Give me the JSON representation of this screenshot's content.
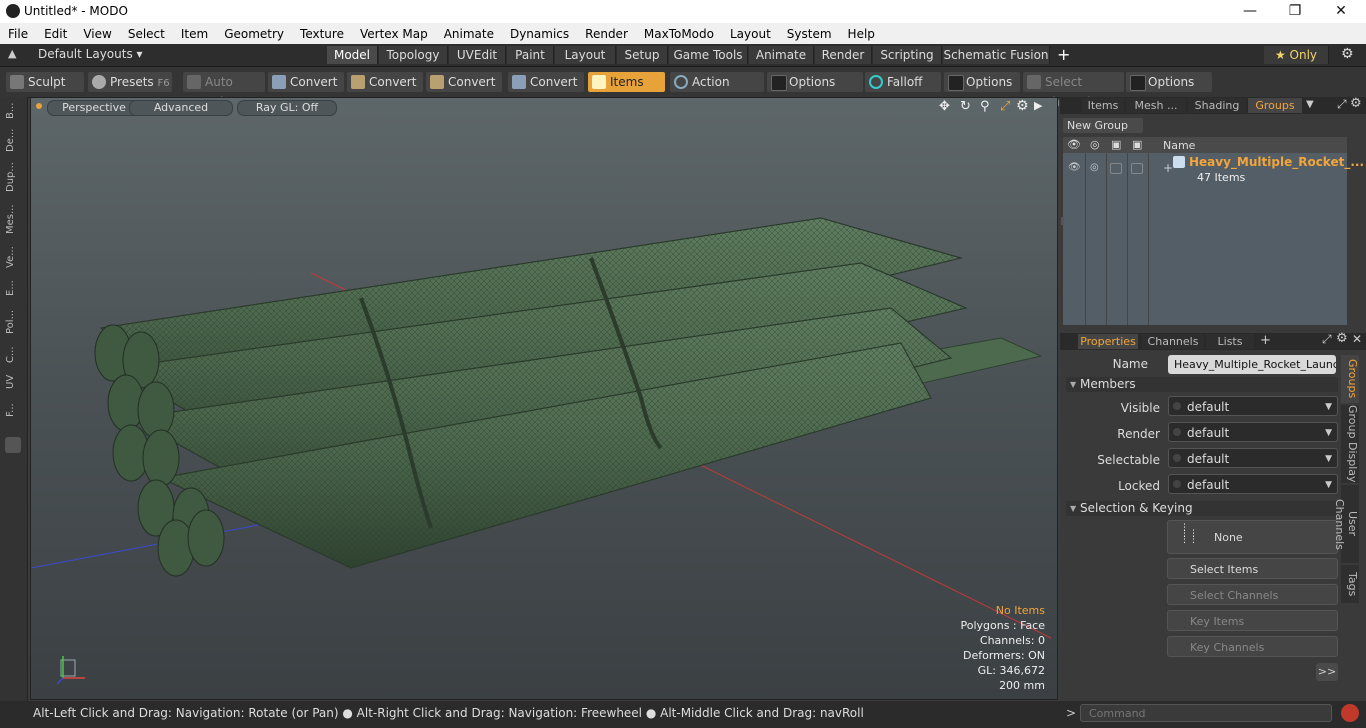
{
  "window": {
    "title": "Untitled* - MODO"
  },
  "menu": [
    "File",
    "Edit",
    "View",
    "Select",
    "Item",
    "Geometry",
    "Texture",
    "Vertex Map",
    "Animate",
    "Dynamics",
    "Render",
    "MaxToModo",
    "Layout",
    "System",
    "Help"
  ],
  "layout_bar": {
    "layouts_label": "Default Layouts ▾",
    "tabs": [
      "Model",
      "Topology",
      "UVEdit",
      "Paint",
      "Layout",
      "Setup",
      "Game Tools",
      "Animate",
      "Render",
      "Scripting",
      "Schematic Fusion"
    ],
    "plus": "+",
    "only_label": "★ Only"
  },
  "toolbar": {
    "sculpt": "Sculpt",
    "presets": "Presets",
    "presets_key": "F6",
    "auto_select": "Auto Select",
    "convert1": "Convert",
    "convert2": "Convert",
    "convert3": "Convert",
    "convert4": "Convert",
    "items": "Items",
    "action_center": "Action Center",
    "options1": "Options",
    "falloff": "Falloff",
    "options2": "Options",
    "select_through": "Select Through",
    "options3": "Options"
  },
  "left_strip": [
    "B...",
    "De...",
    "Dup...",
    "Mes...",
    "Ve...",
    "E...",
    "Pol...",
    "C...",
    "UV",
    "F..."
  ],
  "viewport": {
    "perspective": "Perspective",
    "advanced": "Advanced",
    "raygl": "Ray GL: Off",
    "info": {
      "no_items": "No Items",
      "polygons": "Polygons : Face",
      "channels": "Channels: 0",
      "deformers": "Deformers: ON",
      "gl": "GL: 346,672",
      "size": "200 mm"
    }
  },
  "right_panel": {
    "top_tabs": [
      "Items",
      "Mesh ...",
      "Shading",
      "Groups"
    ],
    "new_group": "New Group",
    "col_name": "Name",
    "group_name": "Heavy_Multiple_Rocket_...",
    "group_count": "47 Items",
    "prop_tabs": [
      "Properties",
      "Channels",
      "Lists"
    ],
    "name_label": "Name",
    "name_value": "Heavy_Multiple_Rocket_Launche",
    "members_header": "Members",
    "fields": [
      {
        "label": "Visible",
        "value": "default"
      },
      {
        "label": "Render",
        "value": "default"
      },
      {
        "label": "Selectable",
        "value": "default"
      },
      {
        "label": "Locked",
        "value": "default"
      }
    ],
    "sel_header": "Selection & Keying",
    "none_label": "None",
    "select_items": "Select Items",
    "select_channels": "Select Channels",
    "key_items": "Key Items",
    "key_channels": "Key Channels",
    "more": ">>",
    "side_tabs": [
      "Groups",
      "Group Display",
      "User Channels",
      "Tags"
    ]
  },
  "status": {
    "hint": "Alt-Left Click and Drag: Navigation: Rotate (or Pan) ● Alt-Right Click and Drag: Navigation: Freewheel ● Alt-Middle Click and Drag: navRoll"
  },
  "command": {
    "prompt": ">",
    "placeholder": "Command"
  },
  "colors": {
    "accent": "#f3a53b",
    "mesh": "#4d6a4f"
  }
}
